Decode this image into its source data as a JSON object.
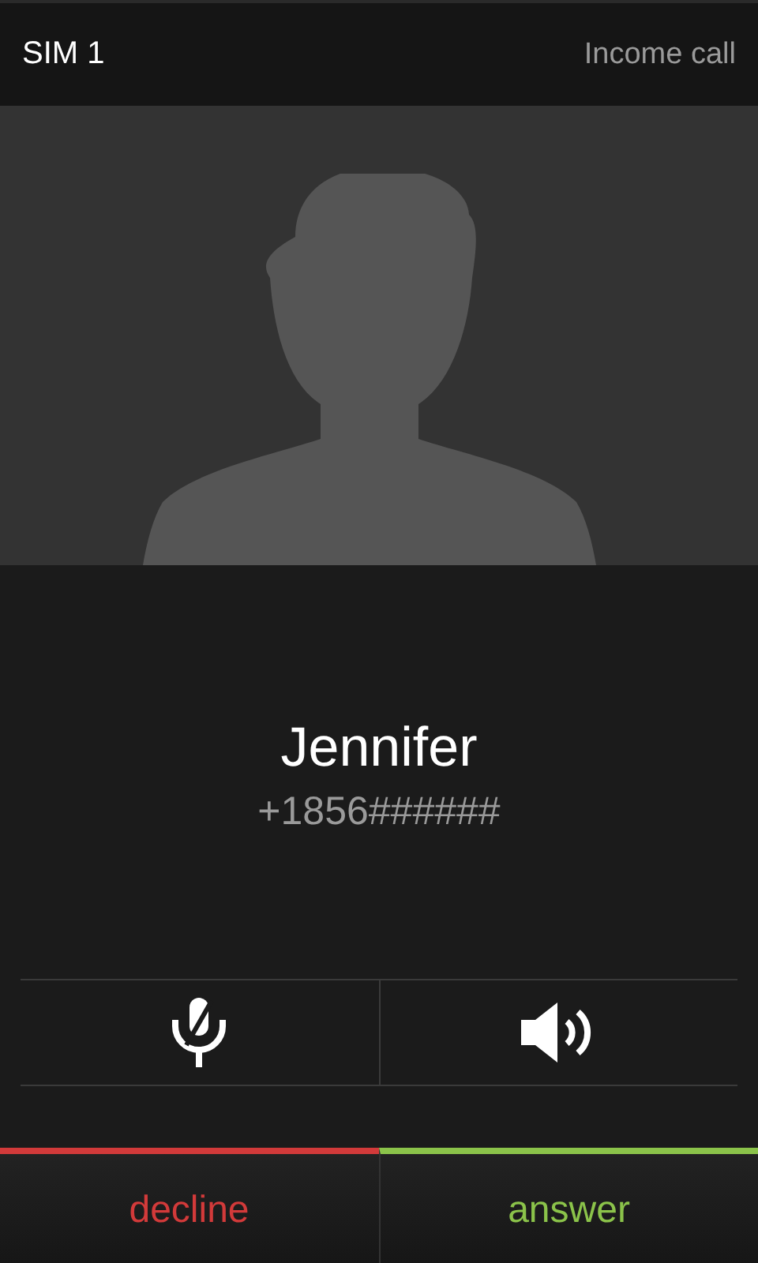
{
  "header": {
    "sim": "SIM 1",
    "status": "Income call"
  },
  "caller": {
    "name": "Jennifer",
    "number": "+1856######"
  },
  "toggles": [
    {
      "kind": "mute"
    },
    {
      "kind": "speaker"
    }
  ],
  "actions": [
    {
      "label": "decline",
      "color": "#d23a3a"
    },
    {
      "label": "answer",
      "color": "#8bc34a"
    }
  ]
}
